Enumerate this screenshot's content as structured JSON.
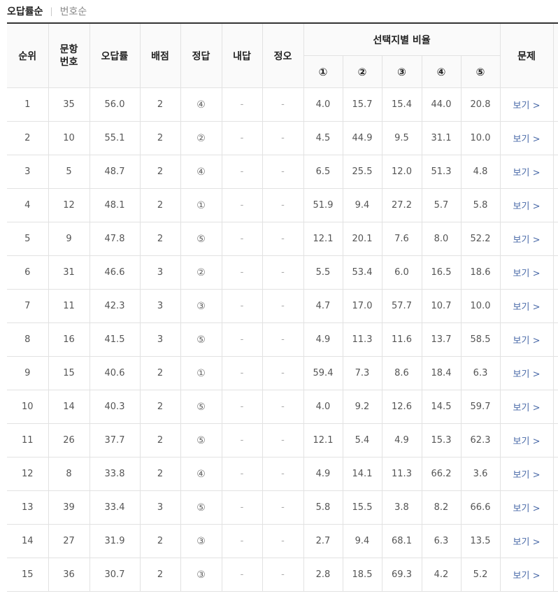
{
  "sort": {
    "active_label": "오답률순",
    "separator": "|",
    "inactive_label": "번호순"
  },
  "table": {
    "headers": {
      "rank": "순위",
      "question_no_line1": "문항",
      "question_no_line2": "번호",
      "error_rate": "오답률",
      "points": "배점",
      "answer": "정답",
      "my_answer": "내답",
      "correct_wrong": "정오",
      "choice_ratio": "선택지별 비율",
      "choices": [
        "①",
        "②",
        "③",
        "④",
        "⑤"
      ],
      "problem": "문제"
    },
    "rows": [
      {
        "rank": "1",
        "no": "35",
        "rate": "56.0",
        "points": "2",
        "answer": "④",
        "my": "-",
        "ox": "-",
        "c1": "4.0",
        "c2": "15.7",
        "c3": "15.4",
        "c4": "44.0",
        "c5": "20.8",
        "view": "보기 >"
      },
      {
        "rank": "2",
        "no": "10",
        "rate": "55.1",
        "points": "2",
        "answer": "②",
        "my": "-",
        "ox": "-",
        "c1": "4.5",
        "c2": "44.9",
        "c3": "9.5",
        "c4": "31.1",
        "c5": "10.0",
        "view": "보기 >"
      },
      {
        "rank": "3",
        "no": "5",
        "rate": "48.7",
        "points": "2",
        "answer": "④",
        "my": "-",
        "ox": "-",
        "c1": "6.5",
        "c2": "25.5",
        "c3": "12.0",
        "c4": "51.3",
        "c5": "4.8",
        "view": "보기 >"
      },
      {
        "rank": "4",
        "no": "12",
        "rate": "48.1",
        "points": "2",
        "answer": "①",
        "my": "-",
        "ox": "-",
        "c1": "51.9",
        "c2": "9.4",
        "c3": "27.2",
        "c4": "5.7",
        "c5": "5.8",
        "view": "보기 >"
      },
      {
        "rank": "5",
        "no": "9",
        "rate": "47.8",
        "points": "2",
        "answer": "⑤",
        "my": "-",
        "ox": "-",
        "c1": "12.1",
        "c2": "20.1",
        "c3": "7.6",
        "c4": "8.0",
        "c5": "52.2",
        "view": "보기 >"
      },
      {
        "rank": "6",
        "no": "31",
        "rate": "46.6",
        "points": "3",
        "answer": "②",
        "my": "-",
        "ox": "-",
        "c1": "5.5",
        "c2": "53.4",
        "c3": "6.0",
        "c4": "16.5",
        "c5": "18.6",
        "view": "보기 >"
      },
      {
        "rank": "7",
        "no": "11",
        "rate": "42.3",
        "points": "3",
        "answer": "③",
        "my": "-",
        "ox": "-",
        "c1": "4.7",
        "c2": "17.0",
        "c3": "57.7",
        "c4": "10.7",
        "c5": "10.0",
        "view": "보기 >"
      },
      {
        "rank": "8",
        "no": "16",
        "rate": "41.5",
        "points": "3",
        "answer": "⑤",
        "my": "-",
        "ox": "-",
        "c1": "4.9",
        "c2": "11.3",
        "c3": "11.6",
        "c4": "13.7",
        "c5": "58.5",
        "view": "보기 >"
      },
      {
        "rank": "9",
        "no": "15",
        "rate": "40.6",
        "points": "2",
        "answer": "①",
        "my": "-",
        "ox": "-",
        "c1": "59.4",
        "c2": "7.3",
        "c3": "8.6",
        "c4": "18.4",
        "c5": "6.3",
        "view": "보기 >"
      },
      {
        "rank": "10",
        "no": "14",
        "rate": "40.3",
        "points": "2",
        "answer": "⑤",
        "my": "-",
        "ox": "-",
        "c1": "4.0",
        "c2": "9.2",
        "c3": "12.6",
        "c4": "14.5",
        "c5": "59.7",
        "view": "보기 >"
      },
      {
        "rank": "11",
        "no": "26",
        "rate": "37.7",
        "points": "2",
        "answer": "⑤",
        "my": "-",
        "ox": "-",
        "c1": "12.1",
        "c2": "5.4",
        "c3": "4.9",
        "c4": "15.3",
        "c5": "62.3",
        "view": "보기 >"
      },
      {
        "rank": "12",
        "no": "8",
        "rate": "33.8",
        "points": "2",
        "answer": "④",
        "my": "-",
        "ox": "-",
        "c1": "4.9",
        "c2": "14.1",
        "c3": "11.3",
        "c4": "66.2",
        "c5": "3.6",
        "view": "보기 >"
      },
      {
        "rank": "13",
        "no": "39",
        "rate": "33.4",
        "points": "3",
        "answer": "⑤",
        "my": "-",
        "ox": "-",
        "c1": "5.8",
        "c2": "15.5",
        "c3": "3.8",
        "c4": "8.2",
        "c5": "66.6",
        "view": "보기 >"
      },
      {
        "rank": "14",
        "no": "27",
        "rate": "31.9",
        "points": "2",
        "answer": "③",
        "my": "-",
        "ox": "-",
        "c1": "2.7",
        "c2": "9.4",
        "c3": "68.1",
        "c4": "6.3",
        "c5": "13.5",
        "view": "보기 >"
      },
      {
        "rank": "15",
        "no": "36",
        "rate": "30.7",
        "points": "2",
        "answer": "③",
        "my": "-",
        "ox": "-",
        "c1": "2.8",
        "c2": "18.5",
        "c3": "69.3",
        "c4": "4.2",
        "c5": "5.2",
        "view": "보기 >"
      }
    ]
  }
}
